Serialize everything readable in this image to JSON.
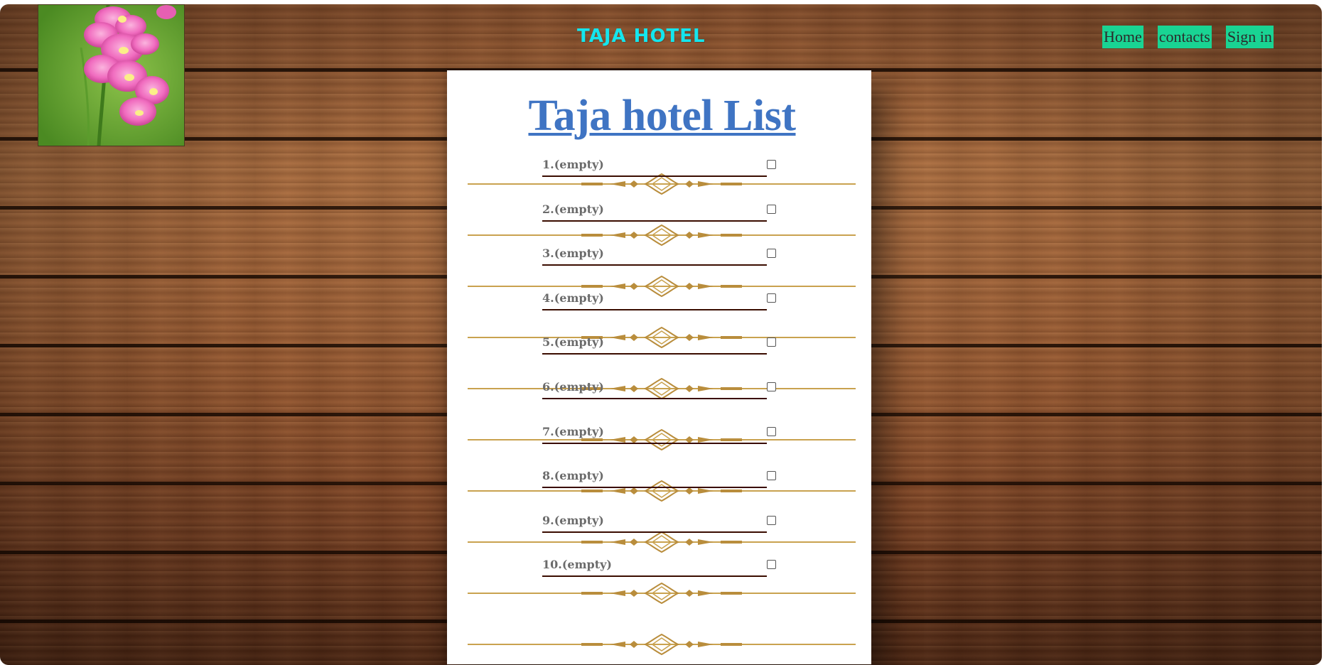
{
  "header": {
    "site_title": "TAJA HOTEL",
    "nav": [
      "Home",
      "contacts",
      "Sign in"
    ]
  },
  "logo": {
    "icon": "gladiolus-flower-image"
  },
  "list": {
    "title": "Taja hotel List",
    "items": [
      {
        "label": "1.(empty)",
        "checked": false
      },
      {
        "label": "2.(empty)",
        "checked": false
      },
      {
        "label": "3.(empty)",
        "checked": false
      },
      {
        "label": "4.(empty)",
        "checked": false
      },
      {
        "label": "5.(empty)",
        "checked": false
      },
      {
        "label": "6.(empty)",
        "checked": false
      },
      {
        "label": "7.(empty)",
        "checked": false
      },
      {
        "label": "8.(empty)",
        "checked": false
      },
      {
        "label": "9.(empty)",
        "checked": false
      },
      {
        "label": "10.(empty)",
        "checked": false
      }
    ]
  },
  "colors": {
    "title_cyan": "#14e6ee",
    "nav_green": "#19d493",
    "list_title_blue": "#3f74c3",
    "divider_gold": "#c9a24f"
  }
}
